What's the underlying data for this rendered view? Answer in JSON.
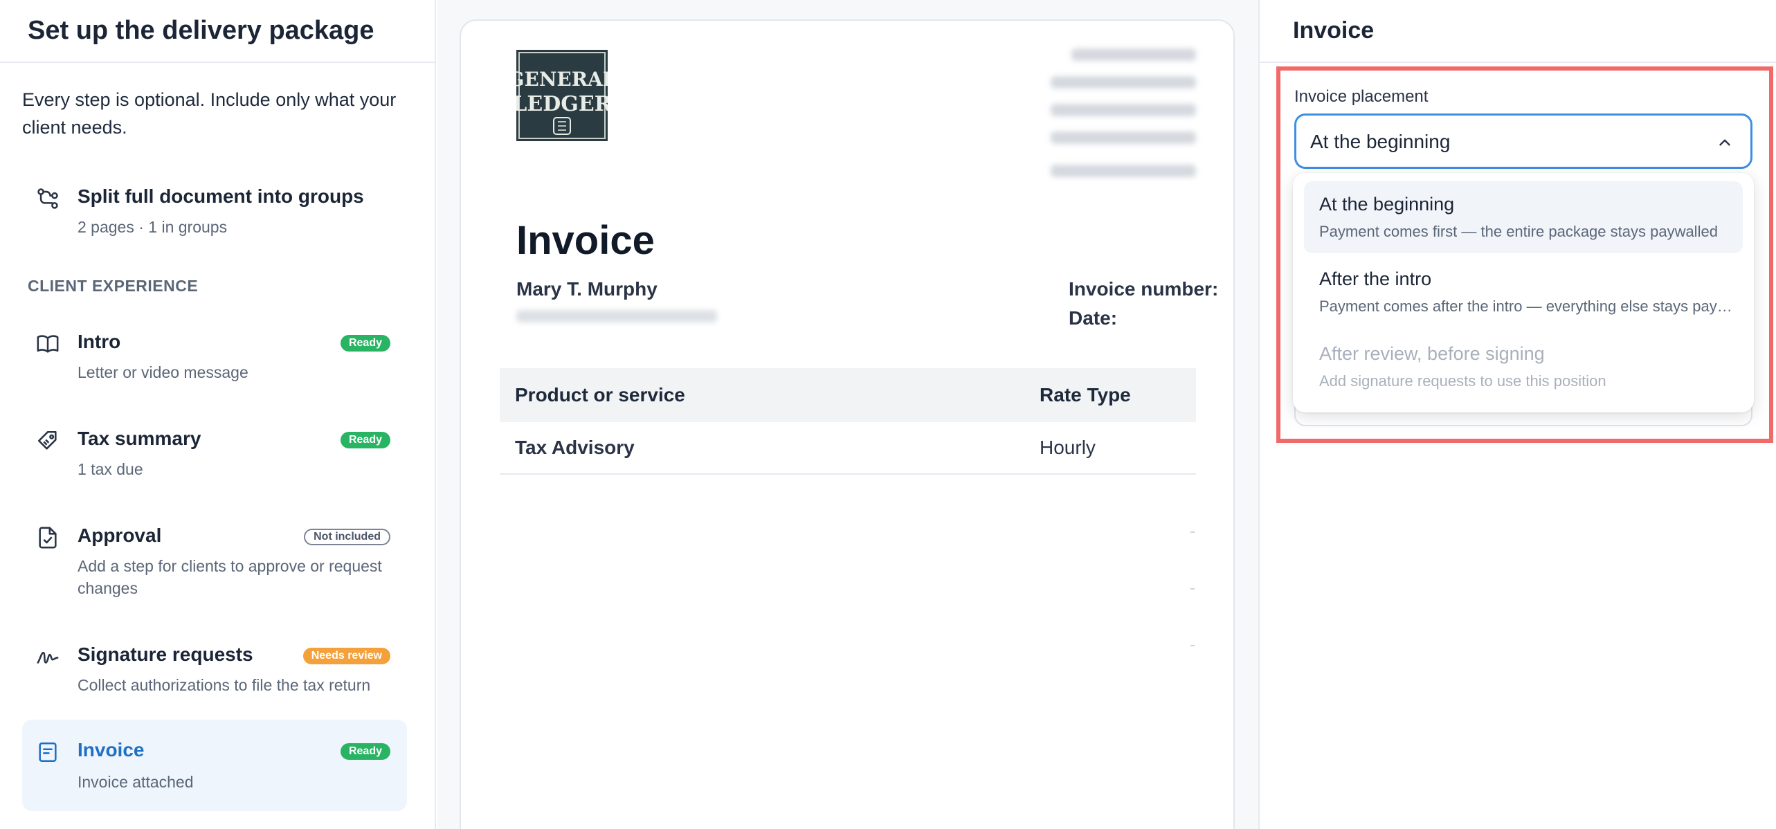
{
  "sidebar": {
    "title": "Set up the delivery package",
    "intro": "Every step is optional. Include only what your client needs.",
    "section_label": "CLIENT EXPERIENCE",
    "items": [
      {
        "name": "Split full document into groups",
        "sub": "2 pages · 1 in groups",
        "icon": "split-icon"
      },
      {
        "name": "Intro",
        "sub": "Letter or video message",
        "badge": "Ready",
        "icon": "book-icon"
      },
      {
        "name": "Tax summary",
        "sub": "1 tax due",
        "badge": "Ready",
        "icon": "tag-icon"
      },
      {
        "name": "Approval",
        "sub": "Add a step for clients to approve or request changes",
        "badge": "Not included",
        "icon": "approval-doc-icon"
      },
      {
        "name": "Signature requests",
        "sub": "Collect authorizations to file the tax return",
        "badge": "Needs review",
        "icon": "signature-icon"
      },
      {
        "name": "Invoice",
        "sub": "Invoice attached",
        "badge": "Ready",
        "icon": "invoice-icon"
      }
    ]
  },
  "preview": {
    "logo_line1": "GENERAL",
    "logo_line2": "LEDGER",
    "title": "Invoice",
    "customer_name": "Mary T. Murphy",
    "invoice_number_label": "Invoice number:",
    "date_label": "Date:",
    "table": {
      "columns": [
        "Product or service",
        "Rate Type"
      ],
      "rows": [
        [
          "Tax Advisory",
          "Hourly"
        ]
      ]
    }
  },
  "panel": {
    "title": "Invoice",
    "field_label": "Invoice placement",
    "selected_value": "At the beginning",
    "options": [
      {
        "title": "At the beginning",
        "desc": "Payment comes first — the entire package stays paywalled",
        "state": "selected"
      },
      {
        "title": "After the intro",
        "desc": "Payment comes after the intro — everything else stays paywalled",
        "state": "enabled"
      },
      {
        "title": "After review, before signing",
        "desc": "Add signature requests to use this position",
        "state": "disabled"
      }
    ]
  },
  "colors": {
    "accent": "#1f6fc5",
    "ready": "#28b463",
    "needs_review": "#f5a13b",
    "highlight": "#f06a6a"
  }
}
